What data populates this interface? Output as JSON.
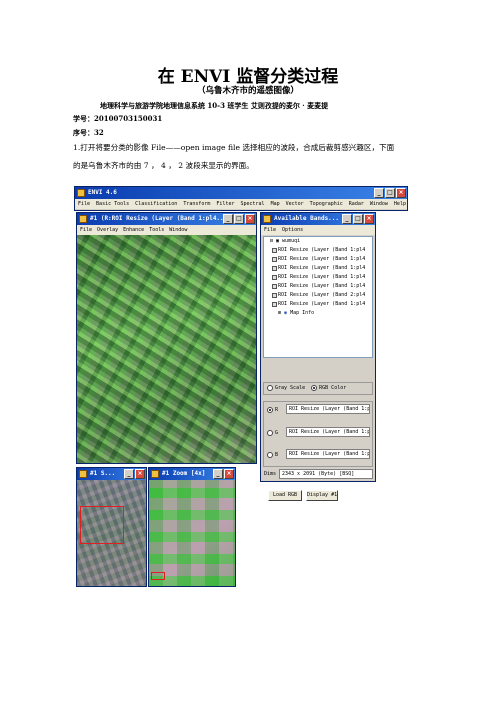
{
  "doc": {
    "title": "在 ENVI 监督分类过程",
    "subtitle": "（乌鲁木齐市的遥感图像）",
    "affiliation": "地理科学与旅游学院地理信息系统 10-3 班学生 艾则孜提的麦尔 · 麦麦提",
    "student_id": "学号：20100703150031",
    "serial": "序号：32",
    "step1_line1": "1.打开将要分类的影像 File——open image file 选择相应的波段，合成后裁剪感兴趣区，下面",
    "step1_line2": "的是乌鲁木齐市的由 7 ， 4 ， 2 波段来显示的界面。"
  },
  "envi_main": {
    "title": "ENVI 4.6",
    "menu": [
      "File",
      "Basic Tools",
      "Classification",
      "Transform",
      "Filter",
      "Spectral",
      "Map",
      "Vector",
      "Topographic",
      "Radar",
      "Window",
      "Help"
    ]
  },
  "image_window": {
    "title": "#1 (R:ROI Resize (Layer (Band 1:pl4...",
    "menu": [
      "File",
      "Overlay",
      "Enhance",
      "Tools",
      "Window"
    ]
  },
  "bands_window": {
    "title": "Available Bands...",
    "menu": [
      "File",
      "Options"
    ],
    "tree_root": "wumuqi",
    "tree_items": [
      "ROI Resize (Layer (Band 1:pl4",
      "ROI Resize (Layer (Band 1:pl4",
      "ROI Resize (Layer (Band 1:pl4",
      "ROI Resize (Layer (Band 1:pl4",
      "ROI Resize (Layer (Band 1:pl4",
      "ROI Resize (Layer (Band 2:pl4",
      "ROI Resize (Layer (Band 1:pl4"
    ],
    "map_info": "Map Info",
    "mode_gray": "Gray Scale",
    "mode_rgb": "RGB Color",
    "channels": [
      {
        "label": "R",
        "value": "ROI Resize (Layer (Band 1:pl4"
      },
      {
        "label": "G",
        "value": "ROI Resize (Layer (Band 1:pl4"
      },
      {
        "label": "B",
        "value": "ROI Resize (Layer (Band 1:pl4"
      }
    ],
    "dims_label": "Dims",
    "dims_value": "2343 x 2091 (Byte) [BSQ]",
    "load_button": "Load RGB",
    "display_button": "Display #1"
  },
  "scroll_window": {
    "title": "#1 S..."
  },
  "zoom_window": {
    "title": "#1 Zoom [4x]"
  }
}
